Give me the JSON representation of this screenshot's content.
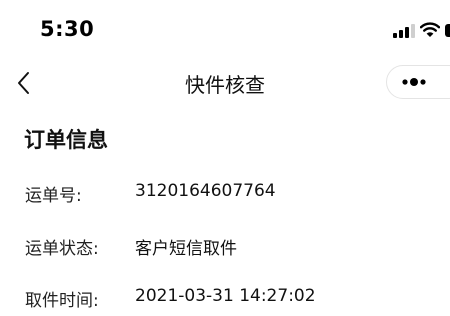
{
  "status_bar": {
    "time": "5:30",
    "icons": [
      "cellular-signal-icon",
      "wifi-icon",
      "battery-icon"
    ]
  },
  "nav": {
    "back_icon": "chevron-left-icon",
    "title": "快件核查",
    "more_icon": "more-dots-icon"
  },
  "section": {
    "title": "订单信息"
  },
  "info_rows": [
    {
      "label": "运单号:",
      "value": "3120164607764"
    },
    {
      "label": "运单状态:",
      "value": "客户短信取件"
    },
    {
      "label": "取件时间:",
      "value": "2021-03-31 14:27:02"
    }
  ],
  "colors": {
    "background": "#ffffff",
    "text": "#111111",
    "capsule_border": "#e4e4e4"
  }
}
